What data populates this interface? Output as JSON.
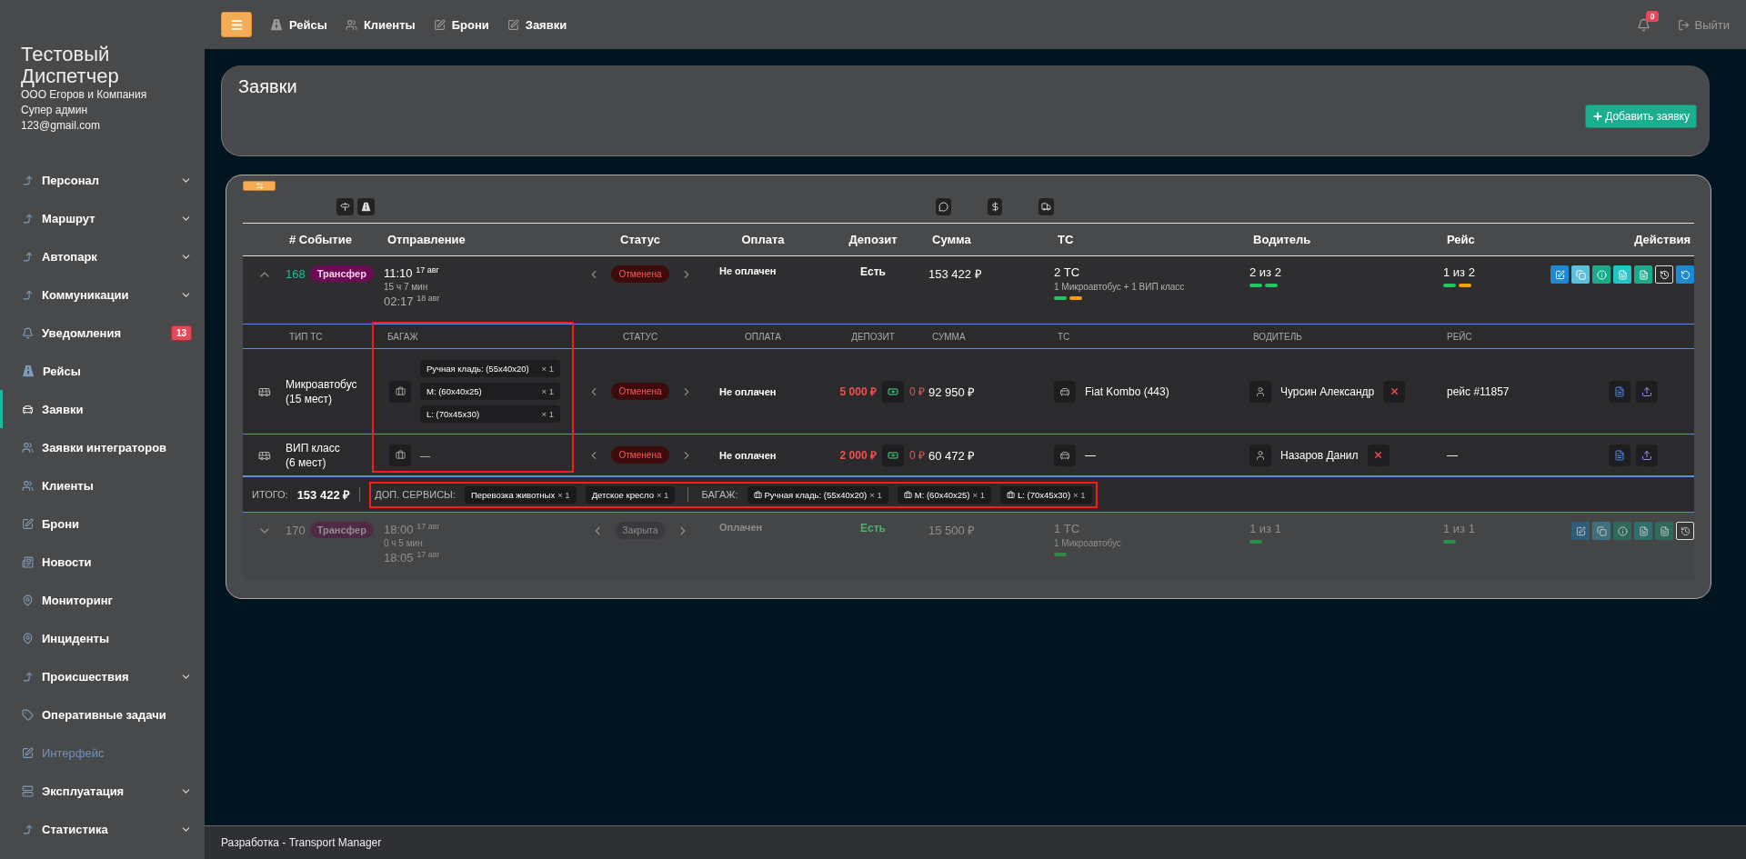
{
  "sidebar": {
    "title": "Тестовый Диспетчер",
    "company": "ООО Егоров и Компания",
    "role": "Супер админ",
    "email": "123@gmail.com",
    "items": [
      {
        "label": "Персонал",
        "expandable": true,
        "selected": false,
        "disabled": false
      },
      {
        "label": "Маршрут",
        "expandable": true,
        "selected": false,
        "disabled": false
      },
      {
        "label": "Автопарк",
        "expandable": true,
        "selected": false,
        "disabled": false
      },
      {
        "label": "Коммуникации",
        "expandable": true,
        "selected": false,
        "disabled": false
      },
      {
        "label": "Уведомления",
        "expandable": false,
        "selected": false,
        "disabled": false,
        "badge": "13"
      },
      {
        "label": "Рейсы",
        "expandable": false,
        "selected": false,
        "disabled": false
      },
      {
        "label": "Заявки",
        "expandable": false,
        "selected": true,
        "disabled": false
      },
      {
        "label": "Заявки интеграторов",
        "expandable": false,
        "selected": false,
        "disabled": false
      },
      {
        "label": "Клиенты",
        "expandable": false,
        "selected": false,
        "disabled": false
      },
      {
        "label": "Брони",
        "expandable": false,
        "selected": false,
        "disabled": false
      },
      {
        "label": "Новости",
        "expandable": false,
        "selected": false,
        "disabled": false
      },
      {
        "label": "Мониторинг",
        "expandable": false,
        "selected": false,
        "disabled": false
      },
      {
        "label": "Инциденты",
        "expandable": false,
        "selected": false,
        "disabled": false
      },
      {
        "label": "Происшествия",
        "expandable": true,
        "selected": false,
        "disabled": false
      },
      {
        "label": "Оперативные задачи",
        "expandable": false,
        "selected": false,
        "disabled": false
      },
      {
        "label": "Интерфейс",
        "expandable": false,
        "selected": false,
        "disabled": true
      },
      {
        "label": "Эксплуатация",
        "expandable": true,
        "selected": false,
        "disabled": false
      },
      {
        "label": "Статистика",
        "expandable": true,
        "selected": false,
        "disabled": false
      }
    ]
  },
  "topbar": {
    "links": [
      {
        "label": "Рейсы"
      },
      {
        "label": "Клиенты"
      },
      {
        "label": "Брони"
      },
      {
        "label": "Заявки"
      }
    ],
    "notification_count": "0",
    "logout": "Выйти"
  },
  "page": {
    "title": "Заявки",
    "add_button": "Добавить заявку"
  },
  "table": {
    "columns": [
      "# Событие",
      "Отправление",
      "Статус",
      "Оплата",
      "Депозит",
      "Сумма",
      "ТС",
      "Водитель",
      "Рейс",
      "Действия"
    ],
    "orders": [
      {
        "id": "168",
        "type": "Трансфер",
        "time": "11:10",
        "date": "17 авг",
        "duration": "15 ч 7 мин",
        "arrival": "02:17",
        "arrival_date": "18 авг",
        "status": {
          "label": "Отменена",
          "color": "#3d0b0b"
        },
        "payment": "Не оплачен",
        "deposit": {
          "label": "Есть",
          "color": "#ffffff"
        },
        "sum": "153 422 ₽",
        "ts": "2 ТС",
        "ts_detail": "1 Микроавтобус + 1 ВИП класс",
        "ts_bars": [
          {
            "color": "#22c55e"
          },
          {
            "color": "#f59e0b"
          }
        ],
        "driver": "2 из 2",
        "driver_bars": [
          {
            "color": "#22c55e"
          },
          {
            "color": "#22c55e"
          }
        ],
        "trip": "1 из 2",
        "trip_bars": [
          {
            "color": "#22c55e"
          },
          {
            "color": "#f59e0b"
          }
        ],
        "expanded": true,
        "dimmed": false,
        "actions": [
          {
            "kind": "solid",
            "color": "#1e88d0"
          },
          {
            "kind": "solid",
            "color": "#5bc0de"
          },
          {
            "kind": "solid",
            "color": "#1aab8a"
          },
          {
            "kind": "solid",
            "color": "#20c5c5"
          },
          {
            "kind": "solid",
            "color": "#1aab8a"
          },
          {
            "kind": "outline",
            "color": "#2a2a2a"
          },
          {
            "kind": "solid",
            "color": "#1e88d0"
          }
        ],
        "subtable": {
          "columns": [
            "ТИП ТС",
            "БАГАЖ",
            "СТАТУС",
            "ОПЛАТА",
            "ДЕПОЗИТ",
            "СУММА",
            "ТС",
            "ВОДИТЕЛЬ",
            "РЕЙС"
          ],
          "baggage_highlighted": true,
          "vehicles": [
            {
              "type": "Микроавтобус",
              "seats": "(15 мест)",
              "baggage": [
                {
                  "label": "Ручная кладь: (55x40x20)",
                  "qty": "× 1"
                },
                {
                  "label": "M: (60x40x25)",
                  "qty": "× 1"
                },
                {
                  "label": "L: (70x45x30)",
                  "qty": "× 1"
                }
              ],
              "status": {
                "label": "Отменена",
                "color": "#3d0b0b"
              },
              "payment": "Не оплачен",
              "deposit": "5 000 ₽",
              "deposit_paid": "0 ₽",
              "sum": "92 950 ₽",
              "vehicle": "Fiat Kombo (443)",
              "driver": "Чурсин Александр",
              "trip": "рейс #11857"
            },
            {
              "type": "ВИП класс",
              "seats": "(6 мест)",
              "baggage_empty": "—",
              "status": {
                "label": "Отменена",
                "color": "#3d0b0b"
              },
              "payment": "Не оплачен",
              "deposit": "2 000 ₽",
              "deposit_paid": "0 ₽",
              "sum": "60 472 ₽",
              "vehicle": "—",
              "driver": "Назаров Данил",
              "trip": "—"
            }
          ]
        },
        "summary": {
          "total_label": "ИТОГО:",
          "total": "153 422 ₽",
          "highlighted": true,
          "services_label": "ДОП. СЕРВИСЫ:",
          "services": [
            {
              "label": "Перевозка животных",
              "qty": "× 1"
            },
            {
              "label": "Детское кресло",
              "qty": "× 1"
            }
          ],
          "baggage_label": "БАГАЖ:",
          "baggage": [
            {
              "label": "Ручная кладь: (55x40x20)",
              "qty": "× 1"
            },
            {
              "label": "M: (60x40x25)",
              "qty": "× 1"
            },
            {
              "label": "L: (70x45x30)",
              "qty": "× 1"
            }
          ]
        }
      },
      {
        "id": "170",
        "type": "Трансфер",
        "time": "18:00",
        "date": "17 авг",
        "duration": "0 ч 5 мин",
        "arrival": "18:05",
        "arrival_date": "17 авг",
        "status": {
          "label": "Закрыта",
          "color": "#3a3a3c"
        },
        "payment": "Оплачен",
        "deposit": {
          "label": "Есть",
          "color": "#4caf6a"
        },
        "sum": "15 500 ₽",
        "ts": "1 ТС",
        "ts_detail": "1 Микроавтобус",
        "ts_bars": [
          {
            "color": "#2f8a4c"
          }
        ],
        "driver": "1 из 1",
        "driver_bars": [
          {
            "color": "#2f8a4c"
          }
        ],
        "trip": "1 из 1",
        "trip_bars": [
          {
            "color": "#2f8a4c"
          }
        ],
        "expanded": false,
        "dimmed": true,
        "actions": [
          {
            "kind": "solid",
            "color": "#2e5d7c"
          },
          {
            "kind": "solid",
            "color": "#42707e"
          },
          {
            "kind": "solid",
            "color": "#2e6a5c"
          },
          {
            "kind": "solid",
            "color": "#2f6e6e"
          },
          {
            "kind": "solid",
            "color": "#2e6a5c"
          },
          {
            "kind": "outline",
            "color": "#3a3a3c"
          }
        ]
      }
    ]
  },
  "footer": "Разработка - Transport Manager"
}
